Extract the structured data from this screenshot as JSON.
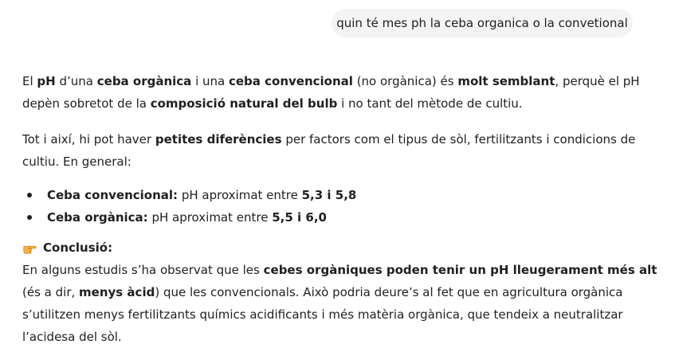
{
  "user_message": "quin té mes ph la ceba organica o la convetional",
  "answer": {
    "p1": {
      "s1": "El ",
      "b1": "pH",
      "s2": " d’una ",
      "b2": "ceba orgànica",
      "s3": " i una ",
      "b3": "ceba convencional",
      "s4": " (no orgànica) és ",
      "b4": "molt semblant",
      "s5": ", perquè el pH depèn sobretot de la ",
      "b5": "composició natural del bulb",
      "s6": " i no tant del mètode de cultiu."
    },
    "p2": {
      "s1": "Tot i així, hi pot haver ",
      "b1": "petites diferències",
      "s2": " per factors com el tipus de sòl, fertilitzants i condicions de cultiu. En general:"
    },
    "bullets": [
      {
        "label": "Ceba convencional:",
        "text": " pH aproximat entre ",
        "range": "5,3 i 5,8"
      },
      {
        "label": "Ceba orgànica:",
        "text": " pH aproximat entre ",
        "range": "5,5 i 6,0"
      }
    ],
    "conclusion": {
      "icon": "pointing-hand-icon",
      "title": "Conclusió:",
      "s1": "En alguns estudis s’ha observat que les ",
      "b1": "cebes orgàniques poden tenir un pH lleugerament més alt",
      "s2": " (és a dir, ",
      "b2": "menys àcid",
      "s3": ") que les convencionals. Això podria deure’s al fet que en agricultura orgànica s’utilitzen menys fertilitzants químics acidificants i més matèria orgànica, que tendeix a neutralitzar l’acidesa del sòl."
    }
  }
}
